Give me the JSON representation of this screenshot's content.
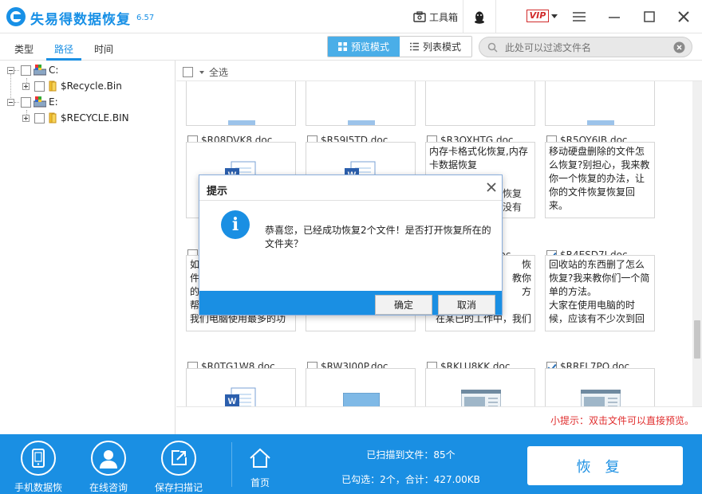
{
  "app": {
    "name": "失易得数据恢复",
    "version": "6.57",
    "toolbox_label": "工具箱",
    "vip_label": "VIP"
  },
  "nav_tabs": [
    {
      "label": "类型"
    },
    {
      "label": "路径"
    },
    {
      "label": "时间"
    }
  ],
  "view_modes": {
    "preview": "预览模式",
    "list": "列表模式"
  },
  "filter": {
    "placeholder": "此处可以过滤文件名",
    "value": ""
  },
  "tree": {
    "drives": [
      {
        "label": "C:",
        "children": [
          {
            "label": "$Recycle.Bin"
          }
        ]
      },
      {
        "label": "E:",
        "children": [
          {
            "label": "$RECYCLE.BIN"
          }
        ]
      }
    ]
  },
  "select_all": "全选",
  "files_row1": [
    {
      "name": "$R08DVK8.doc",
      "checked": false
    },
    {
      "name": "$R59I5TD.doc",
      "checked": false
    },
    {
      "name": "$R3OXHTG.doc",
      "checked": false
    },
    {
      "name": "$R5OY6JB.doc",
      "checked": false
    }
  ],
  "files_row2": [
    {
      "name": "",
      "checked": false,
      "thumb": ""
    },
    {
      "name": "",
      "checked": false,
      "thumb": ""
    },
    {
      "name": ".doc",
      "checked": false,
      "thumb": "内存卡格式化恢复,内存卡数据恢复"
    },
    {
      "name": "$R4ESD7I.doc",
      "checked": true,
      "thumb": "移动硬盘删除的文件怎么恢复?别担心，我来教你一个恢复的办法，让你的文件恢复恢复回来。"
    }
  ],
  "files_row3": [
    {
      "name": "$R0TG1W8.doc",
      "checked": false,
      "thumb": "如\n件\n的\n帮\n我们电脑使用最多的功"
    },
    {
      "name": "$RW3I00P.doc",
      "checked": false,
      "thumb": ""
    },
    {
      "name": "$RKLU8KK.doc",
      "checked": false,
      "thumb": "恢\n教你\n方\n\n在某已的工作中，我们"
    },
    {
      "name": "$RRFL7PO.doc",
      "checked": true,
      "thumb": "回收站的东西删了怎么恢复?我来教你们一个简单的方法。\n大家在使用电脑的时候，应该有不少次到回"
    }
  ],
  "row2_partial_text": {
    "c3a": "恢复",
    "c3b": "没有"
  },
  "hint": "小提示：双击文件可以直接预览。",
  "bottom": {
    "nav": [
      {
        "label": "手机数据恢复"
      },
      {
        "label": "在线咨询"
      },
      {
        "label": "保存扫描记录"
      }
    ],
    "home": "首页",
    "scanned": "已扫描到文件：85个",
    "selected": "已勾选：2个，合计：427.00KB",
    "recover": "恢复"
  },
  "dialog": {
    "title": "提示",
    "message": "恭喜您，已经成功恢复2个文件！是否打开恢复所在的文件夹？",
    "ok": "确定",
    "cancel": "取消"
  },
  "colors": {
    "accent": "#1a8fe3",
    "hint": "#e02d2d"
  }
}
